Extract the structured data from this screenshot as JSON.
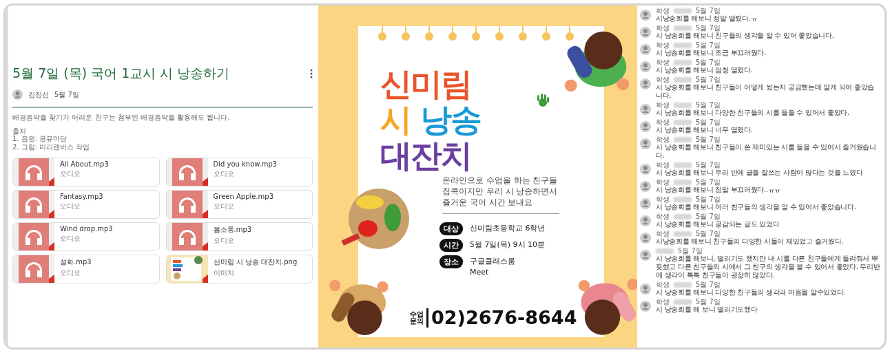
{
  "post": {
    "title": "5월 7일 (목) 국어 1교시 시 낭송하기",
    "author": "김정선",
    "date": "5월 7일",
    "body": [
      "배경음악을 찾기가 어려운 친구는 첨부된 배경음악을 활용해도 됩니다.",
      "출처\n1. 음원: 공유마당\n2. 그림: 미리캔버스 작업"
    ],
    "attachments": [
      {
        "name": "All About.mp3",
        "type": "오디오",
        "kind": "audio"
      },
      {
        "name": "Did you know.mp3",
        "type": "오디오",
        "kind": "audio"
      },
      {
        "name": "Fantasy.mp3",
        "type": "오디오",
        "kind": "audio"
      },
      {
        "name": "Green Apple.mp3",
        "type": "오디오",
        "kind": "audio"
      },
      {
        "name": "Wind drop.mp3",
        "type": "오디오",
        "kind": "audio"
      },
      {
        "name": "봄소풍.mp3",
        "type": "오디오",
        "kind": "audio"
      },
      {
        "name": "설화.mp3",
        "type": "오디오",
        "kind": "audio"
      },
      {
        "name": "신미림 시 낭송 대잔치.png",
        "type": "이미지",
        "kind": "image"
      }
    ]
  },
  "poster": {
    "title_lines": [
      [
        {
          "text": "신미림",
          "color": "#e8552b"
        }
      ],
      [
        {
          "text": "시",
          "color": "#f5a623"
        },
        {
          "text": "낭송",
          "color": "#1a9ad6"
        }
      ],
      [
        {
          "text": "대잔치",
          "color": "#6a3fa0"
        }
      ]
    ],
    "description": [
      "온라인으로 수업을 하는 친구들",
      "집콕이지만 우리 시 낭송하면서",
      "즐거운 국어 시간 보내요"
    ],
    "info": [
      {
        "label": "대상",
        "lines": [
          "신미림초등학교 6학년"
        ]
      },
      {
        "label": "시간",
        "lines": [
          "5월 7일(목) 9시 10분"
        ]
      },
      {
        "label": "장소",
        "lines": [
          "구글클래스룸",
          "Meet"
        ]
      }
    ],
    "contact_label": [
      "수업",
      "문의"
    ],
    "phone": "02)2676-8644"
  },
  "comments": [
    {
      "author": "학생",
      "date": "5월 7일",
      "text": "시낭송회를 해보니 정말 떨렸다.ㅠ"
    },
    {
      "author": "학생",
      "date": "5월 7일",
      "text": "시 낭송회를 해보니 친구들의 생각을 알 수 있어 좋았습니다."
    },
    {
      "author": "학생",
      "date": "5월 7일",
      "text": "시 낭송회를 해보니 조금 부끄러웠다."
    },
    {
      "author": "학생",
      "date": "5월 7일",
      "text": "시 낭송회를 해보니  엄청 떨렸다."
    },
    {
      "author": "학생",
      "date": "5월 7일",
      "text": "시 낭송회를 해보니 친구들이 어떻게 썼는지 궁금했는데 알게 되어 좋았습니다."
    },
    {
      "author": "학생",
      "date": "5월 7일",
      "text": "시 낭송회를 해보니 다양한 친구들의 시를 들을 수 있어서 좋았다."
    },
    {
      "author": "학생",
      "date": "5월 7일",
      "text": "시 낭송회를 해보니 너무 떨렸다."
    },
    {
      "author": "학생",
      "date": "5월 7일",
      "text": "시 낭송회를 해보니 친구들이 쓴 재미있는 시를 들을 수 있어서 즐거웠습니다."
    },
    {
      "author": "학생",
      "date": "5월 7일",
      "text": "시 낭송회를 해보니 우리 반에 글을 잘쓰는 사람이 많다는 것을 느꼈다"
    },
    {
      "author": "학생",
      "date": "5월 7일",
      "text": "시 낭송회를 해보니 정말 부끄러웠다..ㅠㅠ"
    },
    {
      "author": "학생",
      "date": "5월 7일",
      "text": "시 낭송회를 해보니 여러 친구들의 생각을 알 수 있어서 좋았습니다."
    },
    {
      "author": "학생",
      "date": "5월 7일",
      "text": "시 낭송회를 해보니 공감되는 글도 있었다"
    },
    {
      "author": "학생",
      "date": "5월 7일",
      "text": "시낭송회를 해보니 친구들의 다양한 시들이 재밌었고 즐거웠다."
    },
    {
      "date": "5월 7일",
      "text": "시 낭송회를 해보니, 떨리기도 했지만 내 시를 다른 친구들에게 들려줘서 뿌듯했고 다른 친구들의 시에서 그 친구의 생각을 볼 수 있어서 좋았다. 우리반에 생각이 톡톡 친구들이 굉장히 많았다."
    },
    {
      "author": "학생",
      "date": "5월 7일",
      "text": "시 낭송회를 해보니 다양한 친구들의 생각과 마음을 알수있었다."
    },
    {
      "author": "학생",
      "date": "5월 7일",
      "text": "시 낭송회를 해 보니 떨리기도했다"
    }
  ]
}
